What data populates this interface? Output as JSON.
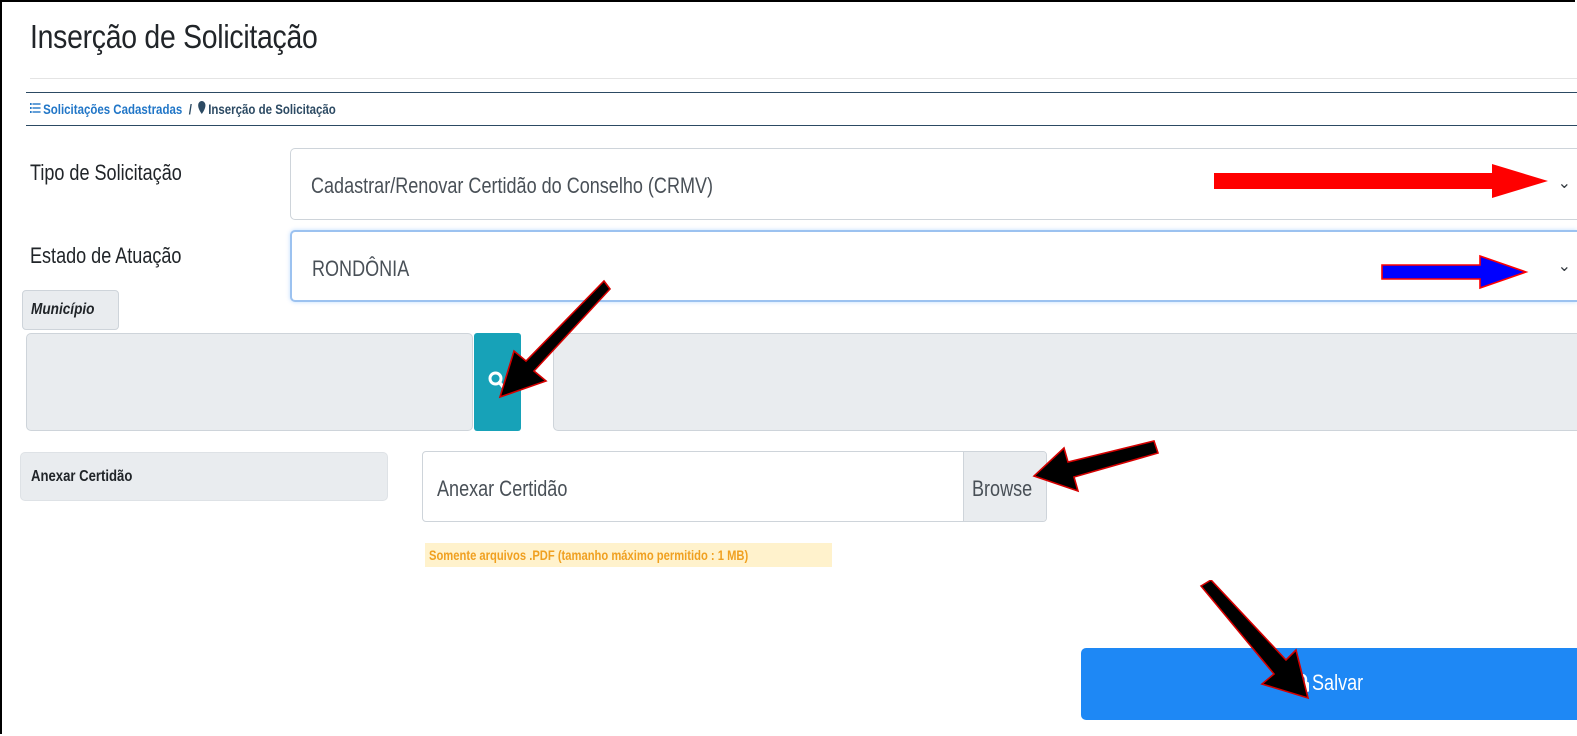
{
  "page": {
    "title": "Inserção de Solicitação"
  },
  "breadcrumb": {
    "list_icon": "list-icon",
    "link_label": "Solicitações Cadastradas",
    "separator": "/",
    "current_icon": "map-marker-icon",
    "current_label": "Inserção de Solicitação"
  },
  "form": {
    "tipo": {
      "label": "Tipo de Solicitação",
      "value": "Cadastrar/Renovar Certidão do Conselho (CRMV)"
    },
    "estado": {
      "label": "Estado de Atuação",
      "value": "RONDÔNIA"
    },
    "municipio": {
      "label": "Município",
      "search_icon": "search-icon"
    },
    "anexo": {
      "label": "Anexar Certidão",
      "placeholder": "Anexar Certidão",
      "browse_label": "Browse",
      "hint": "Somente arquivos .PDF (tamanho máximo permitido : 1 MB)"
    },
    "save": {
      "label": "Salvar",
      "icon": "lock-icon"
    }
  },
  "annotations": {
    "arrow_colors": {
      "red": "#ff0000",
      "blue": "#0000ff",
      "black": "#000000"
    }
  },
  "colors": {
    "primary": "#1e88f5",
    "info": "#17a2b8",
    "link": "#2176c7",
    "warning_text": "#f0a020",
    "warning_bg": "#fff2cc"
  }
}
